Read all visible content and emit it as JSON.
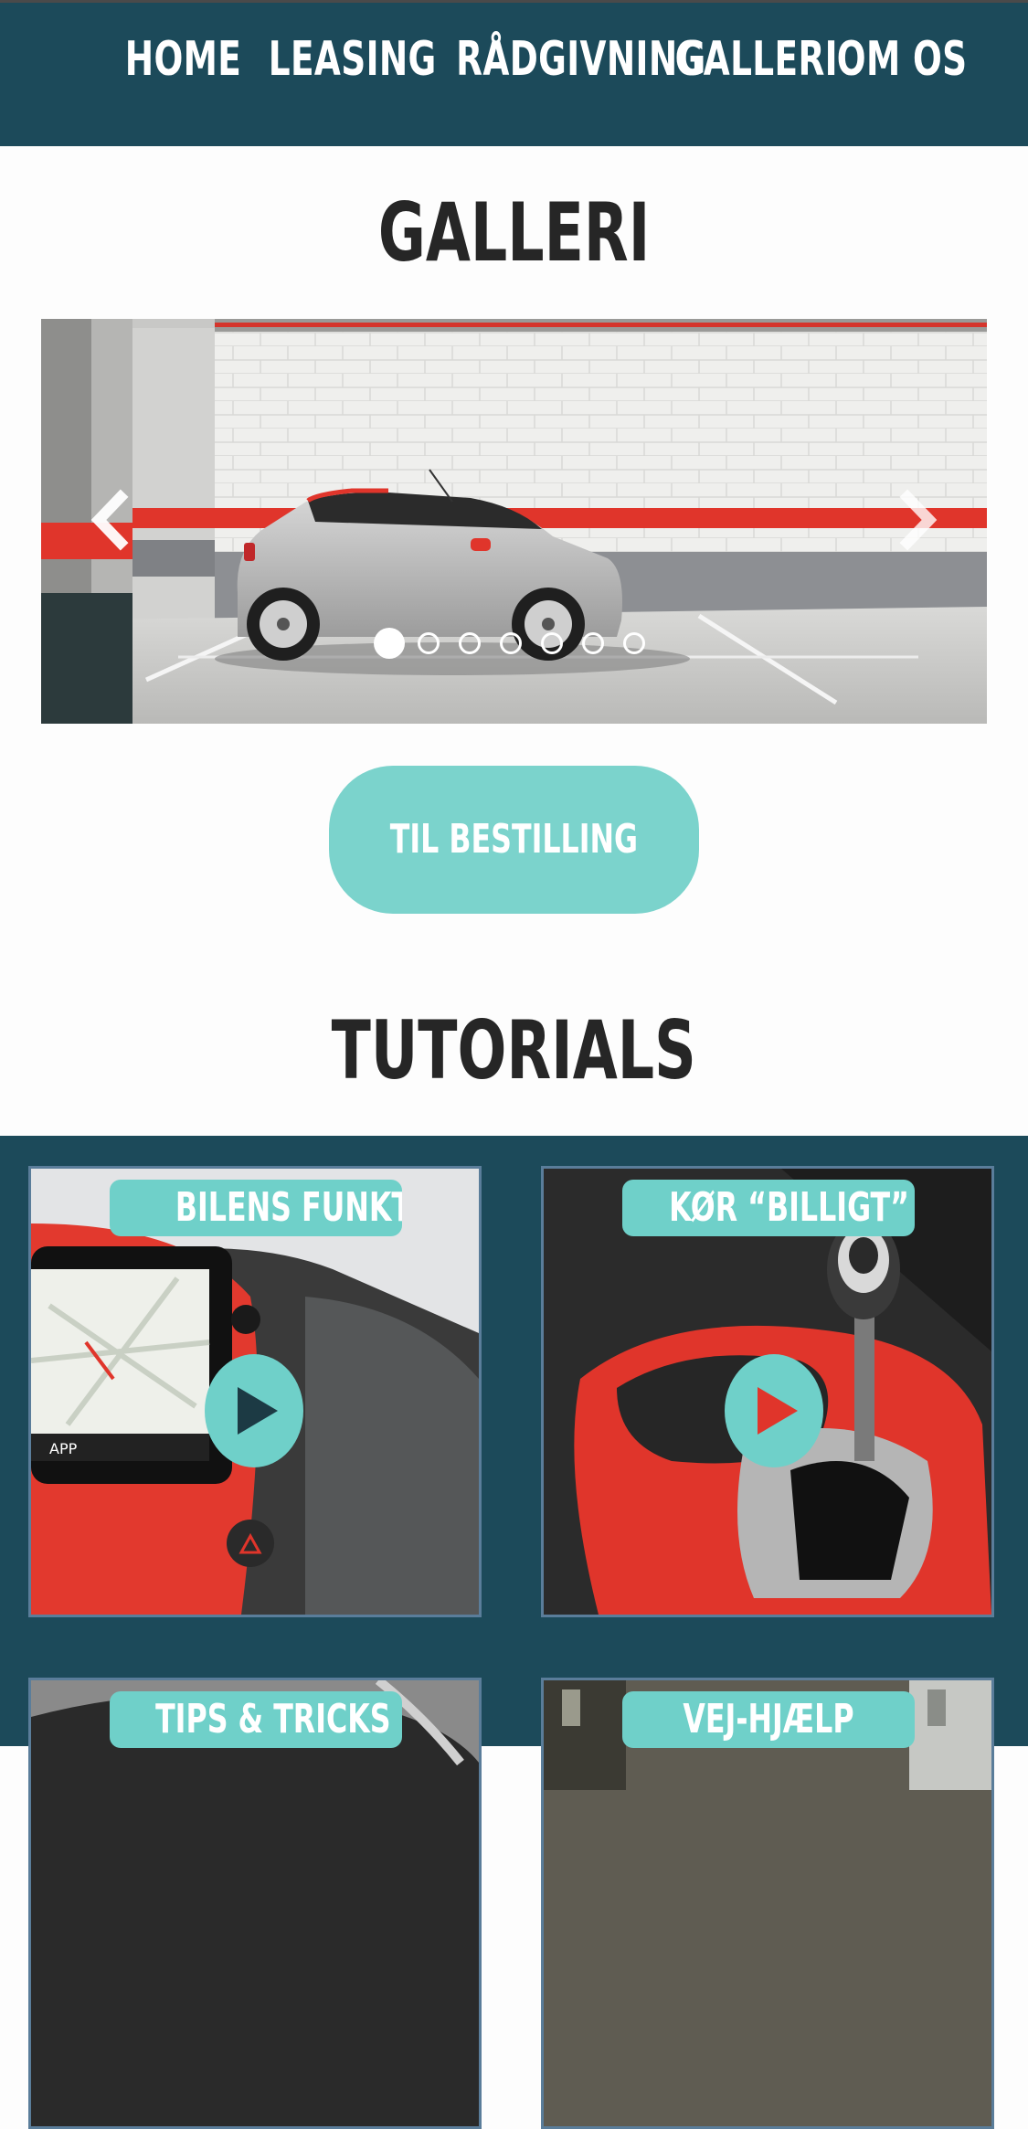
{
  "nav": {
    "items": [
      {
        "label": "HOME"
      },
      {
        "label": "LEASING"
      },
      {
        "label": "RÅDGIVNING"
      },
      {
        "label": "GALLERI"
      },
      {
        "label": "OM OS"
      }
    ]
  },
  "gallery": {
    "title": "GALLERI",
    "slide_count": 7,
    "active_slide": 1,
    "order_button_label": "TIL BESTILLING"
  },
  "tutorials": {
    "title": "TUTORIALS",
    "cards": [
      {
        "label": "BILENS FUNKTIONER"
      },
      {
        "label": "KØR “BILLIGT”"
      },
      {
        "label": "TIPS & TRICKS"
      },
      {
        "label": "VEJ-HJÆLP"
      }
    ]
  },
  "colors": {
    "navy": "#1c4a5a",
    "accent_teal": "#7bd3cc",
    "car_red": "#e0352b"
  },
  "icons": {
    "prev": "chevron-left-icon",
    "next": "chevron-right-icon",
    "play": "play-icon"
  }
}
